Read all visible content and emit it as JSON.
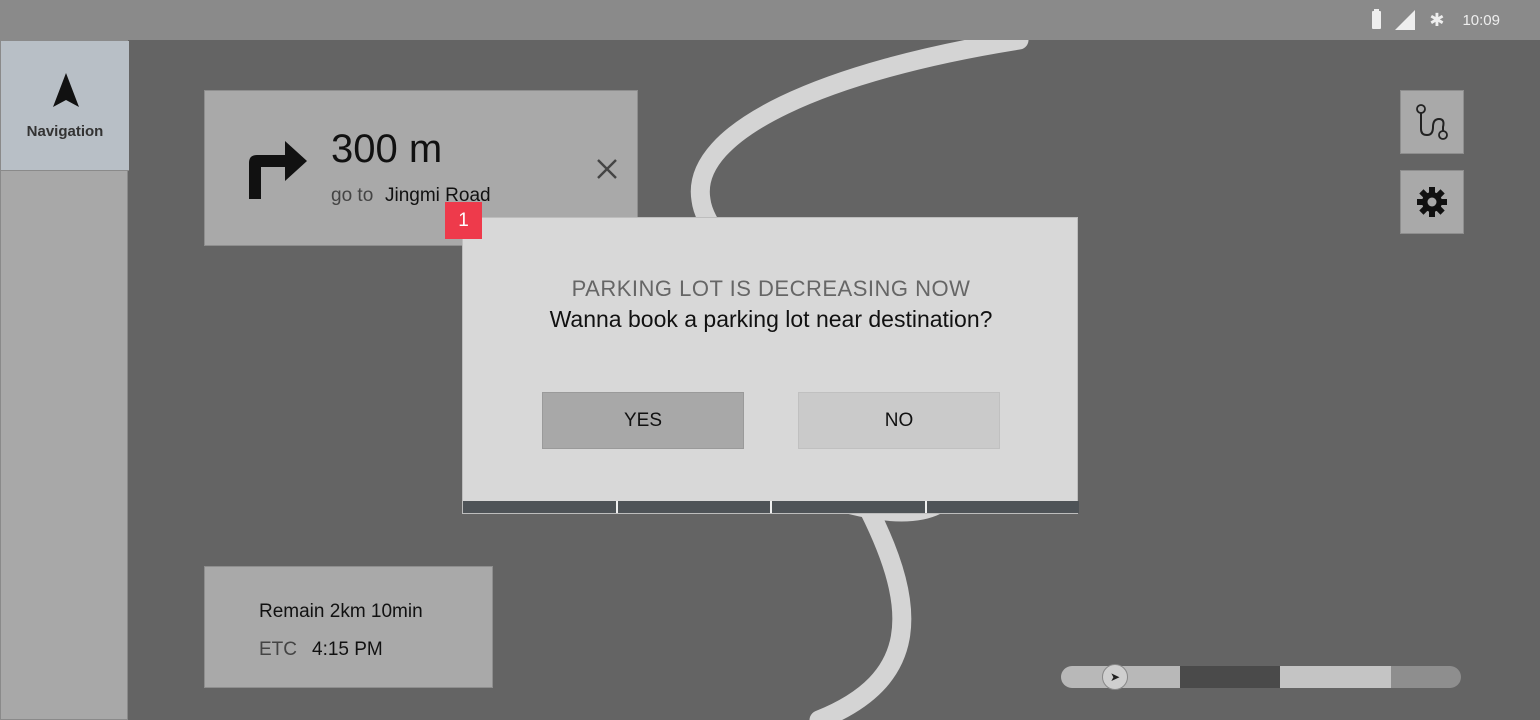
{
  "status_bar": {
    "time": "10:09",
    "icons": [
      "battery-icon",
      "signal-icon",
      "bluetooth-icon"
    ]
  },
  "sidebar": {
    "items": [
      {
        "label": "Navigation",
        "icon": "navigation-arrow-icon",
        "active": true
      }
    ]
  },
  "turn_card": {
    "distance": "300 m",
    "go_to_label": "go to",
    "road": "Jingmi Road",
    "icon": "turn-right-icon"
  },
  "side_buttons": [
    {
      "icon": "route-icon"
    },
    {
      "icon": "gear-icon"
    }
  ],
  "eta_card": {
    "remain": "Remain 2km 10min",
    "etc_label": "ETC",
    "etc_time": "4:15 PM"
  },
  "dialog": {
    "badge": "1",
    "title": "PARKING LOT IS DECREASING NOW",
    "message": "Wanna book a parking lot near destination?",
    "yes_label": "YES",
    "no_label": "NO"
  },
  "progress": {
    "segments_colors": [
      "#b8b8b8",
      "#4a4a4a",
      "#c4c4c4",
      "#8e8e8e"
    ],
    "knob_icon": "play-icon"
  },
  "colors": {
    "map_bg": "#646464",
    "road": "#d4d4d4",
    "badge": "#ee3a4b",
    "status_bar": "#8a8a8a"
  }
}
